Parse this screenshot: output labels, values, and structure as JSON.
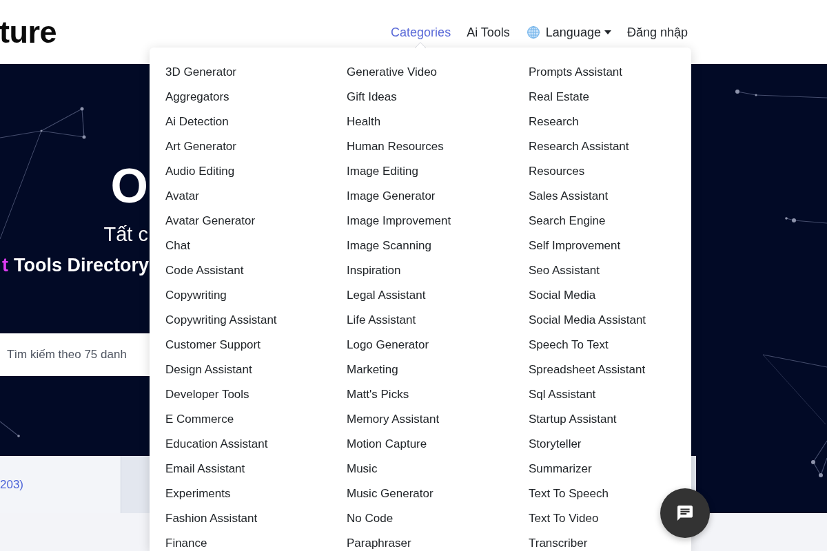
{
  "header": {
    "logo": "ture",
    "nav": [
      {
        "label": "Categories",
        "kind": "link",
        "selected": true
      },
      {
        "label": "Ai Tools",
        "kind": "link",
        "selected": false
      },
      {
        "label": "Language",
        "kind": "language",
        "selected": false
      },
      {
        "label": "Đăng nhập",
        "kind": "link",
        "selected": false
      }
    ]
  },
  "categories_menu": {
    "columns": [
      [
        "3D Generator",
        "Aggregators",
        "Ai Detection",
        "Art Generator",
        "Audio Editing",
        "Avatar",
        "Avatar Generator",
        "Chat",
        "Code Assistant",
        "Copywriting",
        "Copywriting Assistant",
        "Customer Support",
        "Design Assistant",
        "Developer Tools",
        "E Commerce",
        "Education Assistant",
        "Email Assistant",
        "Experiments",
        "Fashion Assistant",
        "Finance"
      ],
      [
        "Generative Video",
        "Gift Ideas",
        "Health",
        "Human Resources",
        "Image Editing",
        "Image Generator",
        "Image Improvement",
        "Image Scanning",
        "Inspiration",
        "Legal Assistant",
        "Life Assistant",
        "Logo Generator",
        "Marketing",
        "Matt's Picks",
        "Memory Assistant",
        "Motion Capture",
        "Music",
        "Music Generator",
        "No Code",
        "Paraphraser"
      ],
      [
        "Prompts Assistant",
        "Real Estate",
        "Research",
        "Research Assistant",
        "Resources",
        "Sales Assistant",
        "Search Engine",
        "Self Improvement",
        "Seo Assistant",
        "Social Media",
        "Social Media Assistant",
        "Speech To Text",
        "Spreadsheet Assistant",
        "Sql Assistant",
        "Startup Assistant",
        "Storyteller",
        "Summarizer",
        "Text To Speech",
        "Text To Video",
        "Transcriber"
      ]
    ]
  },
  "hero": {
    "title": "O",
    "subtitle": "Tất c",
    "tagline_accent": "t",
    "tagline": "Tools Directory",
    "search": {
      "placeholder": "Tìm kiếm theo 75 danh"
    }
  },
  "filter_panel": {
    "count_link": "203)"
  }
}
